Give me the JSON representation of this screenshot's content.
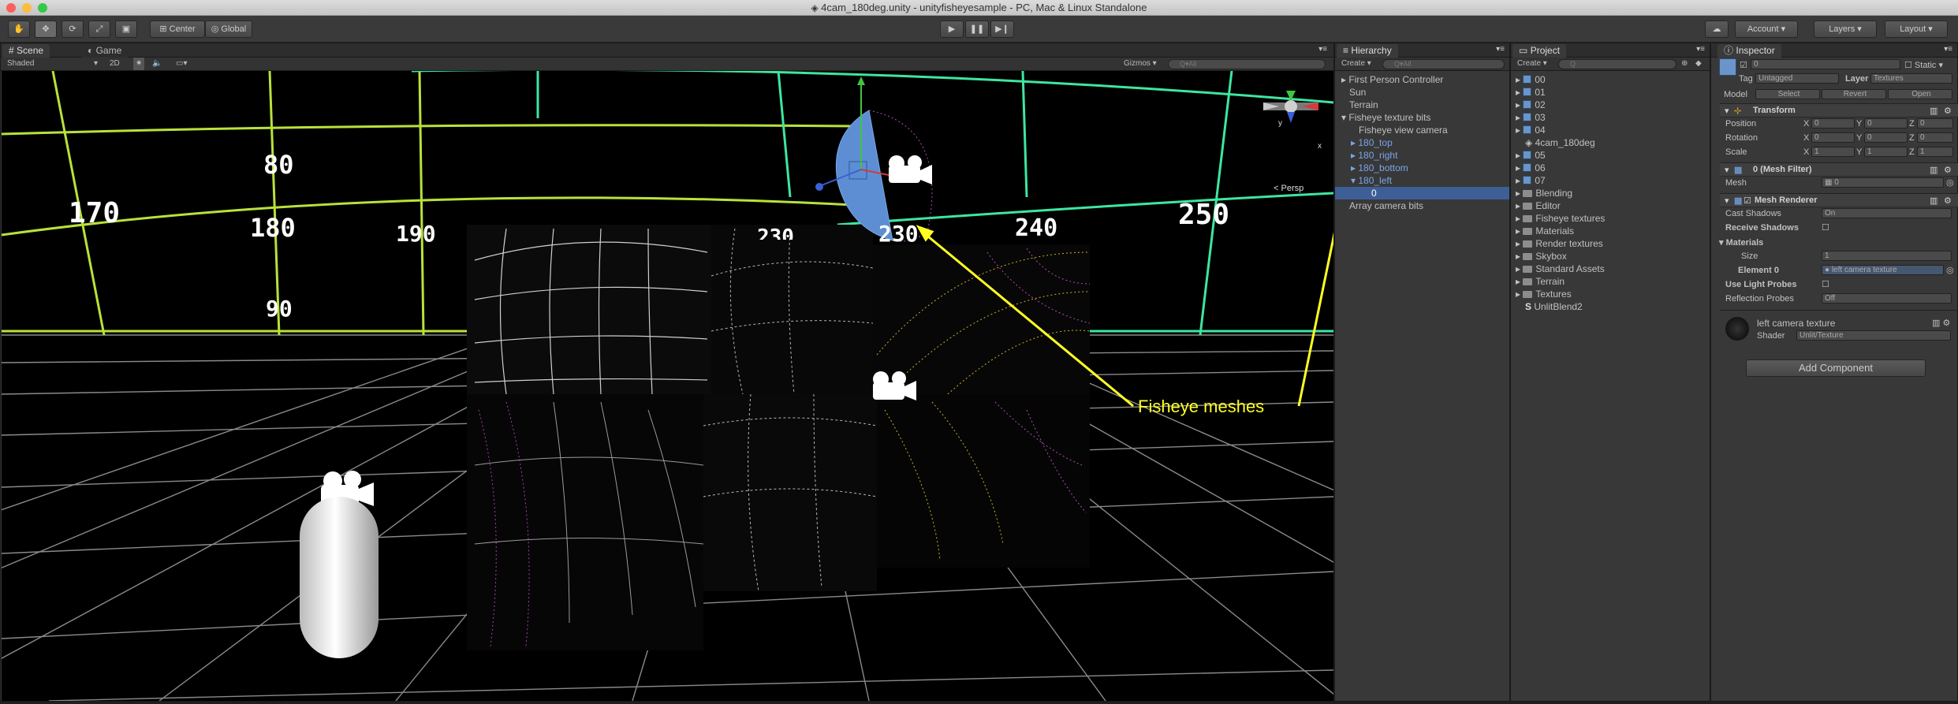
{
  "window": {
    "title": "4cam_180deg.unity - unityfisheyesample - PC, Mac & Linux Standalone"
  },
  "toolbar": {
    "pivot_label": "Center",
    "space_label": "Global",
    "account_label": "Account",
    "layers_label": "Layers",
    "layout_label": "Layout"
  },
  "scene": {
    "tab_scene": "Scene",
    "tab_game": "Game",
    "shading": "Shaded",
    "mode_2d": "2D",
    "gizmos": "Gizmos",
    "search_placeholder": "Q▾All",
    "persp": "Persp",
    "gizmo_y": "y",
    "gizmo_x": "x",
    "numbers": [
      "80",
      "170",
      "180",
      "190",
      "90",
      "230",
      "230",
      "240",
      "250"
    ],
    "annotation": "Fisheye meshes"
  },
  "hierarchy": {
    "tab": "Hierarchy",
    "create": "Create",
    "search_placeholder": "Q▾All",
    "items": [
      "First Person Controller",
      "Sun",
      "Terrain",
      "Fisheye texture bits",
      "Fisheye view camera",
      "180_top",
      "180_right",
      "180_bottom",
      "180_left",
      "0",
      "Array camera bits"
    ]
  },
  "project": {
    "tab": "Project",
    "create": "Create",
    "search_placeholder": "Q",
    "items": [
      "00",
      "01",
      "02",
      "03",
      "04",
      "4cam_180deg",
      "05",
      "06",
      "07",
      "Blending",
      "Editor",
      "Fisheye textures",
      "Materials",
      "Render textures",
      "Skybox",
      "Standard Assets",
      "Terrain",
      "Textures",
      "UnlitBlend2"
    ]
  },
  "inspector": {
    "tab": "Inspector",
    "object_name": "0",
    "static": "Static",
    "tag_label": "Tag",
    "tag_value": "Untagged",
    "layer_label": "Layer",
    "layer_value": "Textures",
    "model_label": "Model",
    "select": "Select",
    "revert": "Revert",
    "open": "Open",
    "transform": "Transform",
    "position": "Position",
    "rotation": "Rotation",
    "scale": "Scale",
    "x": "X",
    "y": "Y",
    "z": "Z",
    "pos": [
      "0",
      "0",
      "0"
    ],
    "rot": [
      "0",
      "0",
      "0"
    ],
    "scl": [
      "1",
      "1",
      "1"
    ],
    "mesh_filter": "0 (Mesh Filter)",
    "mesh_label": "Mesh",
    "mesh_value": "0",
    "mesh_renderer": "Mesh Renderer",
    "cast_shadows": "Cast Shadows",
    "cast_shadows_value": "On",
    "receive_shadows": "Receive Shadows",
    "materials": "Materials",
    "size": "Size",
    "size_value": "1",
    "element0": "Element 0",
    "element0_value": "left camera texture",
    "use_light_probes": "Use Light Probes",
    "reflection_probes": "Reflection Probes",
    "reflection_probes_value": "Off",
    "material_name": "left camera texture",
    "shader_label": "Shader",
    "shader_value": "Unlit/Texture",
    "add_component": "Add Component"
  }
}
